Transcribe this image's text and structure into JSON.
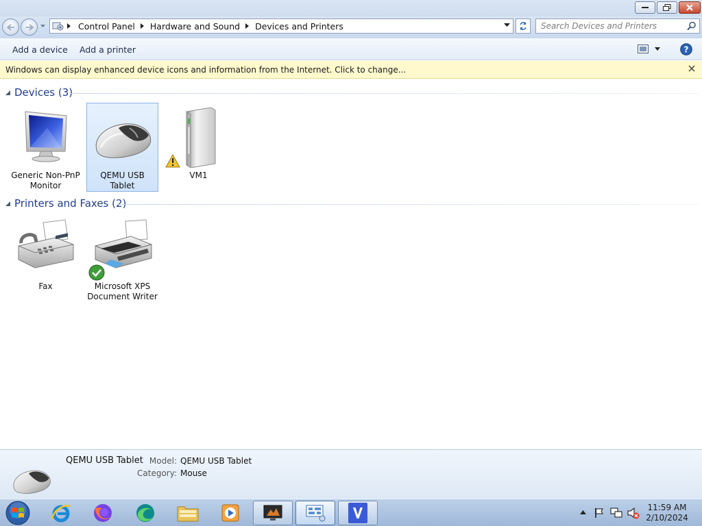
{
  "address": {
    "crumbs": [
      "Control Panel",
      "Hardware and Sound",
      "Devices and Printers"
    ]
  },
  "search": {
    "placeholder": "Search Devices and Printers"
  },
  "commands": {
    "add_device": "Add a device",
    "add_printer": "Add a printer"
  },
  "infobar": {
    "message": "Windows can display enhanced device icons and information from the Internet. Click to change..."
  },
  "groups": {
    "devices": {
      "title": "Devices (3)"
    },
    "printers": {
      "title": "Printers and Faxes (2)"
    }
  },
  "devices": [
    {
      "line1": "Generic Non-PnP",
      "line2": "Monitor",
      "icon": "monitor-icon"
    },
    {
      "line1": "QEMU USB",
      "line2": "Tablet",
      "icon": "mouse-icon",
      "selected": true
    },
    {
      "line1": "VM1",
      "line2": "",
      "icon": "computer-tower-icon",
      "badge": "warning-icon"
    }
  ],
  "printers": [
    {
      "line1": "Fax",
      "line2": "",
      "icon": "fax-icon"
    },
    {
      "line1": "Microsoft XPS",
      "line2": "Document Writer",
      "icon": "printer-icon",
      "badge": "default-check-icon"
    }
  ],
  "details": {
    "name": "QEMU USB Tablet",
    "model_label": "Model:",
    "model_value": "QEMU USB Tablet",
    "category_label": "Category:",
    "category_value": "Mouse"
  },
  "taskbar": {
    "pinned": [
      "internet-explorer-icon",
      "firefox-icon",
      "edge-icon",
      "file-explorer-icon",
      "media-player-icon",
      "screen-icon",
      "devices-printers-icon",
      "v-app-icon"
    ]
  },
  "clock": {
    "time": "11:59 AM",
    "date": "2/10/2024"
  },
  "colors": {
    "accent": "#1e3c8c",
    "infobar": "#fff9cd",
    "selection": "#cfe3fa"
  }
}
